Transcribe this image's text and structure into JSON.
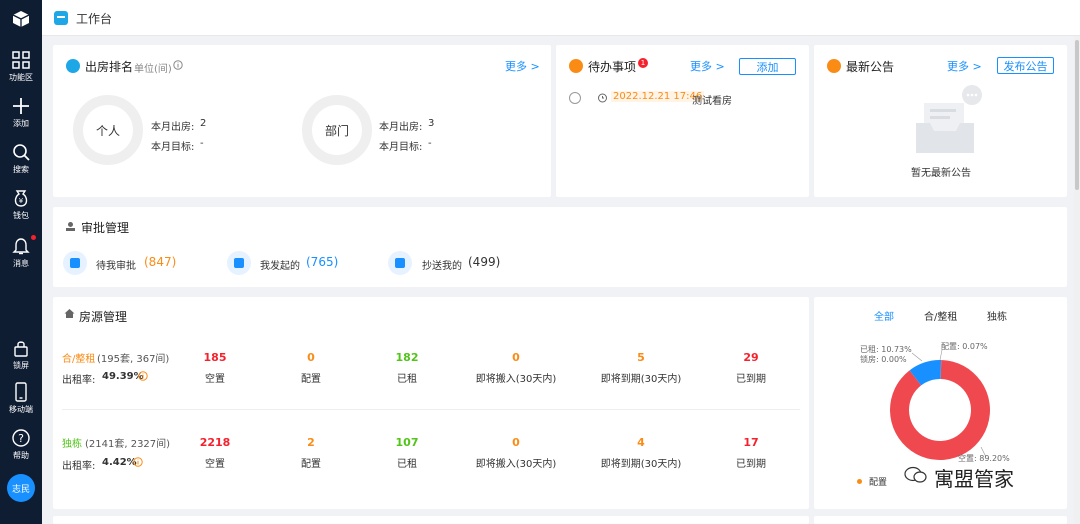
{
  "sidebar": {
    "items": [
      {
        "icon": "grid-icon",
        "label": "功能区"
      },
      {
        "icon": "plus-icon",
        "label": "添加"
      },
      {
        "icon": "search-icon",
        "label": "搜索"
      },
      {
        "icon": "wallet-icon",
        "label": "钱包"
      },
      {
        "icon": "bell-icon",
        "label": "消息"
      },
      {
        "icon": "lock-icon",
        "label": "锁屏"
      },
      {
        "icon": "mobile-icon",
        "label": "移动端"
      },
      {
        "icon": "help-icon",
        "label": "帮助"
      }
    ],
    "avatar": "志民"
  },
  "topbar": {
    "tab_title": "工作台"
  },
  "ranking": {
    "title": "出房排名",
    "unit": "单位(间)",
    "more": "更多 >",
    "personal": {
      "name": "个人",
      "rent_label": "本月出房:",
      "rent_value": "2",
      "target_label": "本月目标:",
      "target_value": "-"
    },
    "department": {
      "name": "部门",
      "rent_label": "本月出房:",
      "rent_value": "3",
      "target_label": "本月目标:",
      "target_value": "-"
    }
  },
  "todo": {
    "title": "待办事项",
    "badge": "1",
    "more": "更多 >",
    "add": "添加",
    "items": [
      {
        "time": "2022.12.21 17:46",
        "text": "测试看房"
      }
    ]
  },
  "notice": {
    "title": "最新公告",
    "more": "更多 >",
    "publish": "发布公告",
    "empty": "暂无最新公告"
  },
  "approval": {
    "title": "审批管理",
    "items": [
      {
        "label": "待我审批",
        "count": "(847)",
        "color": "#fa8c16"
      },
      {
        "label": "我发起的",
        "count": "(765)",
        "color": "#1890ff"
      },
      {
        "label": "抄送我的",
        "count": "(499)",
        "color": "#333333"
      }
    ]
  },
  "housing": {
    "title": "房源管理",
    "groups": [
      {
        "name": "合/整租",
        "name_color": "#fa8c16",
        "detail": "(195套, 367间)",
        "rate_label": "出租率:",
        "rate_value": "49.39%",
        "stats": [
          {
            "value": "185",
            "label": "空置",
            "color": "#f5222d"
          },
          {
            "value": "0",
            "label": "配置",
            "color": "#fa8c16"
          },
          {
            "value": "182",
            "label": "已租",
            "color": "#52c41a"
          },
          {
            "value": "0",
            "label": "即将搬入(30天内)",
            "color": "#fa8c16"
          },
          {
            "value": "5",
            "label": "即将到期(30天内)",
            "color": "#fa8c16"
          },
          {
            "value": "29",
            "label": "已到期",
            "color": "#f5222d"
          }
        ]
      },
      {
        "name": "独栋",
        "name_color": "#52c41a",
        "detail": "(2141套, 2327间)",
        "rate_label": "出租率:",
        "rate_value": "4.42%",
        "stats": [
          {
            "value": "2218",
            "label": "空置",
            "color": "#f5222d"
          },
          {
            "value": "2",
            "label": "配置",
            "color": "#fa8c16"
          },
          {
            "value": "107",
            "label": "已租",
            "color": "#52c41a"
          },
          {
            "value": "0",
            "label": "即将搬入(30天内)",
            "color": "#fa8c16"
          },
          {
            "value": "4",
            "label": "即将到期(30天内)",
            "color": "#fa8c16"
          },
          {
            "value": "17",
            "label": "已到期",
            "color": "#f5222d"
          }
        ]
      }
    ]
  },
  "donut": {
    "tabs": [
      "全部",
      "合/整租",
      "独栋"
    ],
    "active_tab": "全部",
    "labels": {
      "rented": "已租: 10.73%",
      "locked": "锁房: 0.00%",
      "config": "配置: 0.07%",
      "vacant": "空置: 89.20%"
    },
    "legend": [
      "配置"
    ],
    "watermark": "寓盟管家"
  },
  "chart_data": {
    "type": "pie",
    "categories": [
      "空置",
      "已租",
      "配置",
      "锁房"
    ],
    "values": [
      89.2,
      10.73,
      0.07,
      0.0
    ],
    "colors": [
      "#f0484f",
      "#1890ff",
      "#fa8c16",
      "#999999"
    ]
  }
}
